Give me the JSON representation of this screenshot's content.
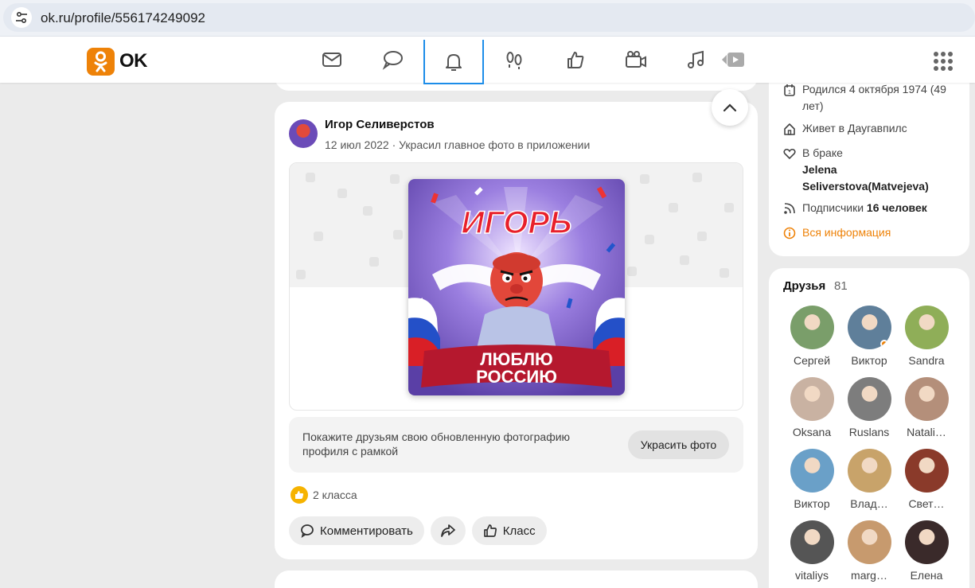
{
  "browser": {
    "url": "ok.ru/profile/556174249092"
  },
  "brand": {
    "logo_text": "OK",
    "accent": "#ee8208",
    "active_nav_color": "#1c8de9"
  },
  "nav": {
    "icons": [
      "mail-icon",
      "chat-icon",
      "bell-icon",
      "guests-icon",
      "likes-icon",
      "video-call-icon",
      "music-icon",
      "video-icon"
    ],
    "active": "bell-icon"
  },
  "post": {
    "author": "Игор Селиверстов",
    "date": "12 июл 2022",
    "action": "Украсил главное фото в приложении",
    "photo": {
      "title": "ИГОРЬ",
      "banner_line1": "ЛЮБЛЮ",
      "banner_line2": "РОССИЮ"
    },
    "promo_text": "Покажите друзьям свою обновленную фотографию профиля с рамкой",
    "promo_button": "Украсить фото",
    "likes_text": "2 класса",
    "comment_label": "Комментировать",
    "like_label": "Класс"
  },
  "profile_info": {
    "born": "Родился 4 октября 1974 (49 лет)",
    "lives": "Живет в Даугавпилс",
    "married_label": "В браке",
    "spouse": "Jelena Seliverstova(Matvejeva)",
    "followers_label": "Подписчики",
    "followers_count": "16 человек",
    "all_info": "Вся информация"
  },
  "friends": {
    "title": "Друзья",
    "count": "81",
    "list": [
      {
        "name": "Сергей",
        "color": "#7a9e6a"
      },
      {
        "name": "Виктор",
        "color": "#5f7f9a",
        "online": true
      },
      {
        "name": "Sandra",
        "color": "#8fae58"
      },
      {
        "name": "Oksana",
        "color": "#c9b2a2"
      },
      {
        "name": "Ruslans",
        "color": "#7d7d7d"
      },
      {
        "name": "Natali…",
        "color": "#b48f7a"
      },
      {
        "name": "Виктор",
        "color": "#6aa0c8"
      },
      {
        "name": "Влад…",
        "color": "#c8a36a"
      },
      {
        "name": "Свет…",
        "color": "#8a3a2a"
      },
      {
        "name": "vitaliys",
        "color": "#555555"
      },
      {
        "name": "marg…",
        "color": "#c79a6e"
      },
      {
        "name": "Елена",
        "color": "#3a2a2a"
      }
    ]
  }
}
